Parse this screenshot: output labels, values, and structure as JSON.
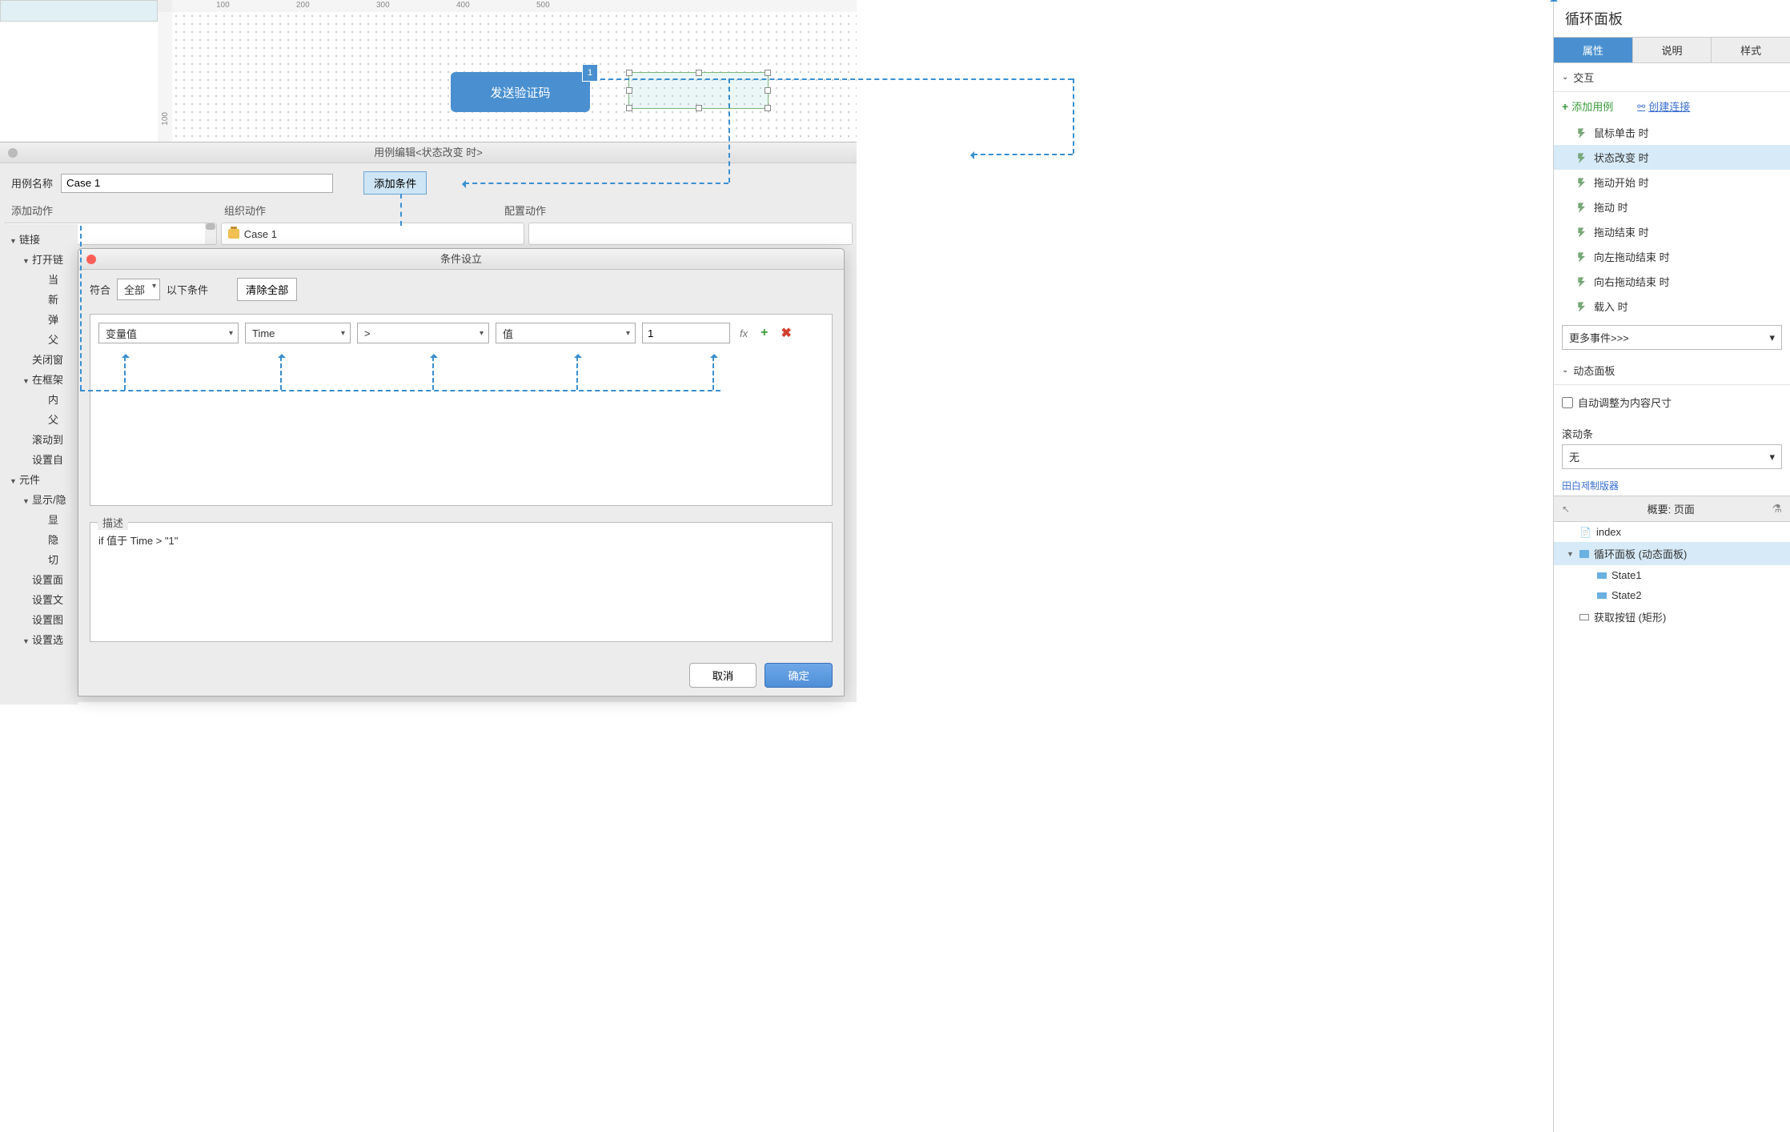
{
  "canvas": {
    "button_text": "发送验证码",
    "badge": "1",
    "ruler_h": [
      "100",
      "200",
      "300",
      "400",
      "500"
    ],
    "ruler_v": [
      "100"
    ]
  },
  "right_panel": {
    "title": "循环面板",
    "tabs": [
      "属性",
      "说明",
      "样式"
    ],
    "interactions_header": "交互",
    "add_case": "添加用例",
    "create_link": "创建连接",
    "events": [
      "鼠标单击 时",
      "状态改变 时",
      "拖动开始 时",
      "拖动 时",
      "拖动结束 时",
      "向左拖动结束 时",
      "向右拖动结束 时",
      "载入 时"
    ],
    "selected_event_index": 1,
    "more_events": "更多事件>>>",
    "dyn_header": "动态面板",
    "auto_fit": "自动调整为内容尺寸",
    "scroll_label": "滚动条",
    "scroll_value": "无",
    "cutoff": "田白제制版器",
    "outline_title": "概要: 页面",
    "outline": [
      {
        "label": "index",
        "icon": "page",
        "depth": 0,
        "expand": ""
      },
      {
        "label": "循环面板 (动态面板)",
        "icon": "dyn",
        "depth": 0,
        "expand": "▼",
        "sel": true
      },
      {
        "label": "State1",
        "icon": "state",
        "depth": 1,
        "expand": ""
      },
      {
        "label": "State2",
        "icon": "state",
        "depth": 1,
        "expand": ""
      },
      {
        "label": "获取按钮 (矩形)",
        "icon": "rect",
        "depth": 0,
        "expand": ""
      }
    ]
  },
  "case_editor": {
    "title": "用例编辑<状态改变 时>",
    "name_label": "用例名称",
    "name_value": "Case 1",
    "add_condition": "添加条件",
    "col1": "添加动作",
    "col2": "组织动作",
    "col3": "配置动作",
    "case_label": "Case 1",
    "action_tree": [
      {
        "l": "链接",
        "d": 0,
        "t": "▼"
      },
      {
        "l": "打开链",
        "d": 1,
        "t": "▼"
      },
      {
        "l": "当",
        "d": 2,
        "t": ""
      },
      {
        "l": "新",
        "d": 2,
        "t": ""
      },
      {
        "l": "弹",
        "d": 2,
        "t": ""
      },
      {
        "l": "父",
        "d": 2,
        "t": ""
      },
      {
        "l": "关闭窗",
        "d": 1,
        "t": ""
      },
      {
        "l": "在框架",
        "d": 1,
        "t": "▼"
      },
      {
        "l": "内",
        "d": 2,
        "t": ""
      },
      {
        "l": "父",
        "d": 2,
        "t": ""
      },
      {
        "l": "滚动到",
        "d": 1,
        "t": ""
      },
      {
        "l": "设置自",
        "d": 1,
        "t": ""
      },
      {
        "l": "元件",
        "d": 0,
        "t": "▼"
      },
      {
        "l": "显示/隐",
        "d": 1,
        "t": "▼"
      },
      {
        "l": "显",
        "d": 2,
        "t": ""
      },
      {
        "l": "隐",
        "d": 2,
        "t": ""
      },
      {
        "l": "切",
        "d": 2,
        "t": ""
      },
      {
        "l": "设置面",
        "d": 1,
        "t": ""
      },
      {
        "l": "设置文",
        "d": 1,
        "t": ""
      },
      {
        "l": "设置图",
        "d": 1,
        "t": ""
      },
      {
        "l": "设置选",
        "d": 1,
        "t": "▼"
      }
    ]
  },
  "cond_dialog": {
    "title": "条件设立",
    "match_prefix": "符合",
    "match_select": "全部",
    "match_suffix": "以下条件",
    "clear_all": "清除全部",
    "row": {
      "dd1": "变量值",
      "dd2": "Time",
      "dd3": ">",
      "dd4": "值",
      "input": "1",
      "fx": "fx"
    },
    "desc_label": "描述",
    "desc_text": "if 值于 Time > \"1\"",
    "cancel": "取消",
    "ok": "确定"
  }
}
